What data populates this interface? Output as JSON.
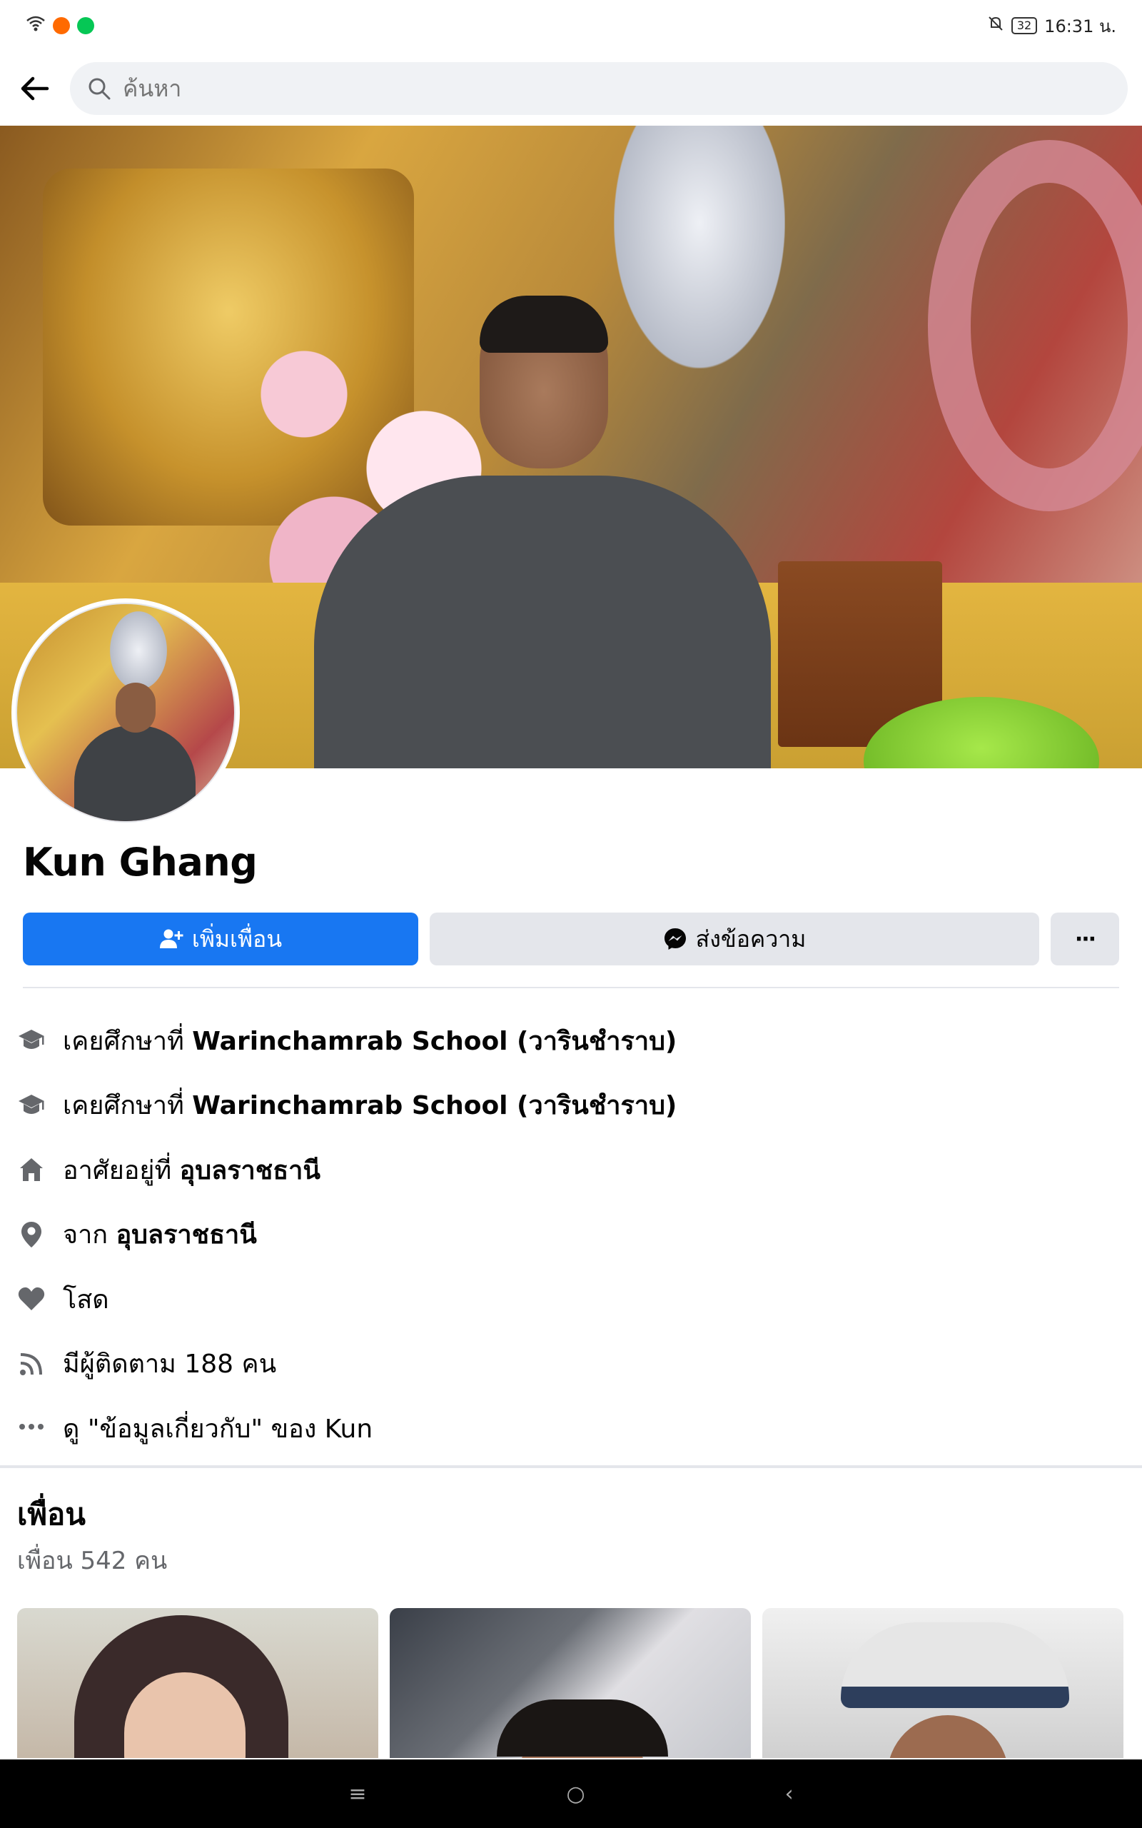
{
  "status_bar": {
    "time": "16:31 น.",
    "battery": "32",
    "colors": {
      "app1": "#ff6a00",
      "app2": "#06c755"
    }
  },
  "search": {
    "placeholder": "ค้นหา"
  },
  "profile": {
    "name": "Kun Ghang",
    "add_friend_label": "เพิ่มเพื่อน",
    "message_label": "ส่งข้อความ",
    "more_label": "···"
  },
  "intro": {
    "items": [
      {
        "icon": "graduation-cap-icon",
        "prefix": "เคยศึกษาที่ ",
        "bold": "Warinchamrab School  (วารินชำราบ)",
        "suffix": ""
      },
      {
        "icon": "graduation-cap-icon",
        "prefix": "เคยศึกษาที่ ",
        "bold": "Warinchamrab School  (วารินชำราบ)",
        "suffix": ""
      },
      {
        "icon": "home-icon",
        "prefix": "อาศัยอยู่ที่ ",
        "bold": "อุบลราชธานี",
        "suffix": ""
      },
      {
        "icon": "location-pin-icon",
        "prefix": "จาก ",
        "bold": "อุบลราชธานี",
        "suffix": ""
      },
      {
        "icon": "heart-icon",
        "prefix": "โสด",
        "bold": "",
        "suffix": ""
      },
      {
        "icon": "rss-icon",
        "prefix": "มีผู้ติดตาม 188 คน",
        "bold": "",
        "suffix": ""
      },
      {
        "icon": "more-dots-icon",
        "prefix": "ดู \"ข้อมูลเกี่ยวกับ\" ของ Kun",
        "bold": "",
        "suffix": ""
      }
    ]
  },
  "friends": {
    "title": "เพื่อน",
    "count": "เพื่อน 542 คน"
  },
  "nav": {
    "menu": "≡",
    "home": "○",
    "back": "‹"
  },
  "colors": {
    "primary": "#1877f2",
    "secondary_bg": "#e4e6eb",
    "muted_text": "#65676b"
  }
}
